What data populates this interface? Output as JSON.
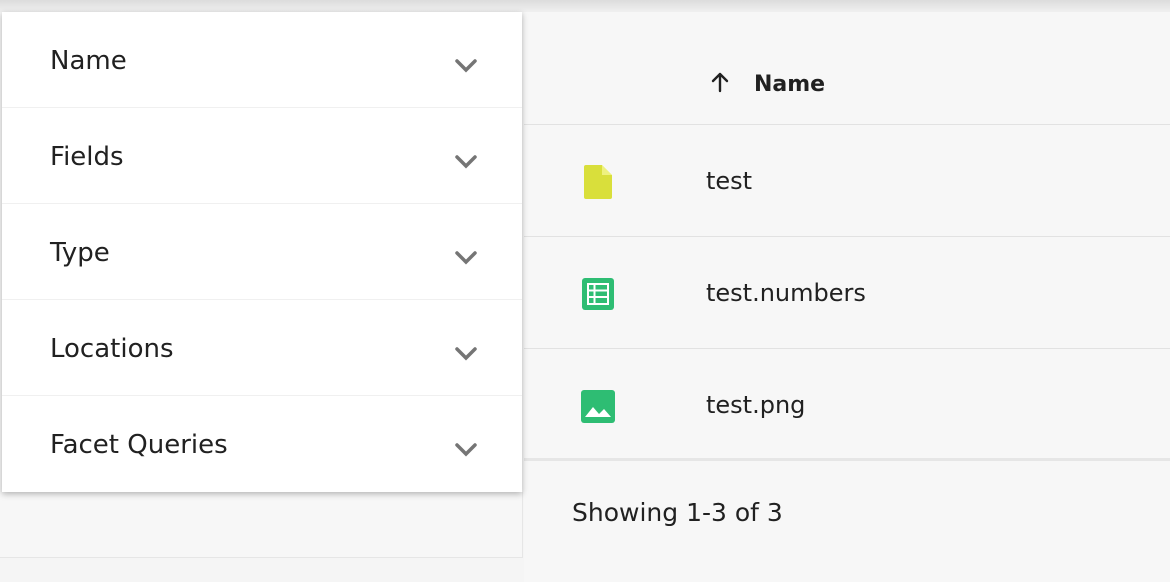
{
  "filters": [
    {
      "label": "Name"
    },
    {
      "label": "Fields"
    },
    {
      "label": "Type"
    },
    {
      "label": "Locations"
    },
    {
      "label": "Facet Queries"
    }
  ],
  "table": {
    "column_header": "Name",
    "sort_icon": "arrow-up-icon",
    "rows": [
      {
        "name": "test",
        "icon": "document-icon",
        "icon_color": "#d9df3b"
      },
      {
        "name": "test.numbers",
        "icon": "spreadsheet-icon",
        "icon_color": "#2ebd73"
      },
      {
        "name": "test.png",
        "icon": "image-icon",
        "icon_color": "#2ebd73"
      }
    ]
  },
  "pagination": {
    "summary": "Showing 1-3 of 3"
  }
}
